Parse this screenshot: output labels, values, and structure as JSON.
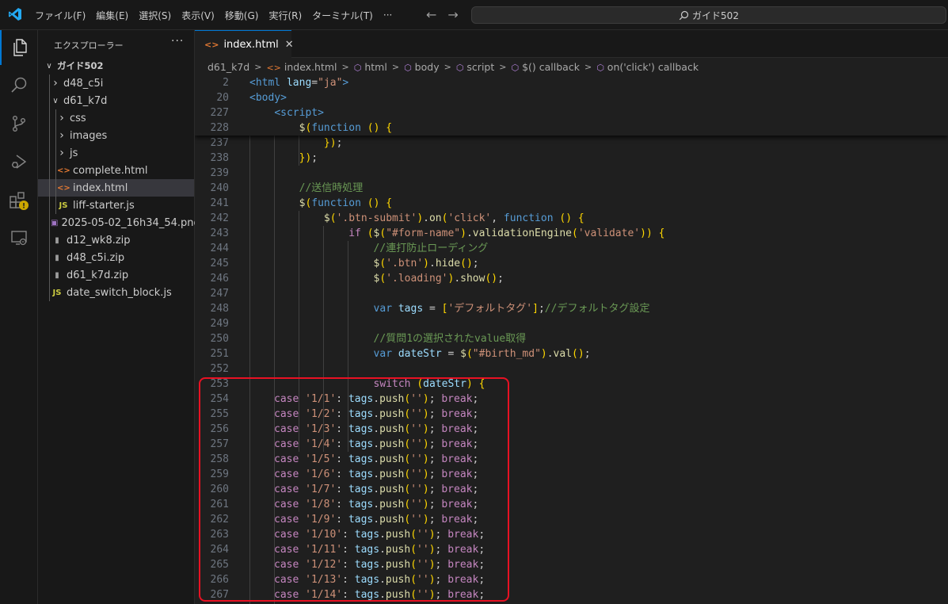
{
  "app": {
    "menu": [
      "ファイル(F)",
      "編集(E)",
      "選択(S)",
      "表示(V)",
      "移動(G)",
      "実行(R)",
      "ターミナル(T)",
      "···"
    ],
    "search_label": "ガイド502",
    "accent": "#0078d4"
  },
  "activity": {
    "icons": [
      "explorer-icon",
      "search-icon",
      "source-control-icon",
      "run-debug-icon",
      "extensions-icon",
      "remote-explorer-icon"
    ],
    "warning_badge": "⚠"
  },
  "sidebar": {
    "title": "エクスプローラー",
    "more": "···",
    "tree": [
      {
        "label": "ガイド502",
        "depth": 0,
        "type": "folder",
        "expanded": true,
        "bold": true
      },
      {
        "label": "d48_c5i",
        "depth": 1,
        "type": "folder",
        "expanded": false
      },
      {
        "label": "d61_k7d",
        "depth": 1,
        "type": "folder",
        "expanded": true
      },
      {
        "label": "css",
        "depth": 2,
        "type": "folder",
        "expanded": false
      },
      {
        "label": "images",
        "depth": 2,
        "type": "folder",
        "expanded": false
      },
      {
        "label": "js",
        "depth": 2,
        "type": "folder",
        "expanded": false
      },
      {
        "label": "complete.html",
        "depth": 2,
        "type": "html"
      },
      {
        "label": "index.html",
        "depth": 2,
        "type": "html",
        "selected": true
      },
      {
        "label": "liff-starter.js",
        "depth": 2,
        "type": "js"
      },
      {
        "label": "2025-05-02_16h34_54.png",
        "depth": 1,
        "type": "png"
      },
      {
        "label": "d12_wk8.zip",
        "depth": 1,
        "type": "zip"
      },
      {
        "label": "d48_c5i.zip",
        "depth": 1,
        "type": "zip"
      },
      {
        "label": "d61_k7d.zip",
        "depth": 1,
        "type": "zip"
      },
      {
        "label": "date_switch_block.js",
        "depth": 1,
        "type": "js"
      }
    ]
  },
  "editor": {
    "tab": {
      "label": "index.html",
      "close": "✕"
    },
    "breadcrumb": [
      "d61_k7d",
      "index.html",
      "html",
      "body",
      "script",
      "$() callback",
      "on('click') callback"
    ],
    "sticky_lines": [
      {
        "n": "2",
        "t": "<html lang=\"ja\">"
      },
      {
        "n": "20",
        "t": "<body>"
      },
      {
        "n": "227",
        "t": "    <script>"
      },
      {
        "n": "228",
        "t": "        $(function () {"
      }
    ],
    "lines": [
      {
        "n": "237",
        "t": "            });"
      },
      {
        "n": "238",
        "t": "        });"
      },
      {
        "n": "239",
        "t": ""
      },
      {
        "n": "240",
        "t": "        //送信時処理"
      },
      {
        "n": "241",
        "t": "        $(function () {"
      },
      {
        "n": "242",
        "t": "            $('.btn-submit').on('click', function () {"
      },
      {
        "n": "243",
        "t": "                if ($(\"#form-name\").validationEngine('validate')) {"
      },
      {
        "n": "244",
        "t": "                    //連打防止ローディング"
      },
      {
        "n": "245",
        "t": "                    $('.btn').hide();"
      },
      {
        "n": "246",
        "t": "                    $('.loading').show();"
      },
      {
        "n": "247",
        "t": ""
      },
      {
        "n": "248",
        "t": "                    var tags = ['デフォルトタグ'];//デフォルトタグ設定"
      },
      {
        "n": "249",
        "t": ""
      },
      {
        "n": "250",
        "t": "                    //質問1の選択されたvalue取得"
      },
      {
        "n": "251",
        "t": "                    var dateStr = $(\"#birth_md\").val();"
      },
      {
        "n": "252",
        "t": ""
      },
      {
        "n": "253",
        "t": "                    switch (dateStr) {"
      },
      {
        "n": "254",
        "t": "case '1/1': tags.push(''); break;"
      },
      {
        "n": "255",
        "t": "case '1/2': tags.push(''); break;"
      },
      {
        "n": "256",
        "t": "case '1/3': tags.push(''); break;"
      },
      {
        "n": "257",
        "t": "case '1/4': tags.push(''); break;"
      },
      {
        "n": "258",
        "t": "case '1/5': tags.push(''); break;"
      },
      {
        "n": "259",
        "t": "case '1/6': tags.push(''); break;"
      },
      {
        "n": "260",
        "t": "case '1/7': tags.push(''); break;"
      },
      {
        "n": "261",
        "t": "case '1/8': tags.push(''); break;"
      },
      {
        "n": "262",
        "t": "case '1/9': tags.push(''); break;"
      },
      {
        "n": "263",
        "t": "case '1/10': tags.push(''); break;"
      },
      {
        "n": "264",
        "t": "case '1/11': tags.push(''); break;"
      },
      {
        "n": "265",
        "t": "case '1/12': tags.push(''); break;"
      },
      {
        "n": "266",
        "t": "case '1/13': tags.push(''); break;"
      },
      {
        "n": "267",
        "t": "case '1/14': tags.push(''); break;"
      }
    ]
  }
}
